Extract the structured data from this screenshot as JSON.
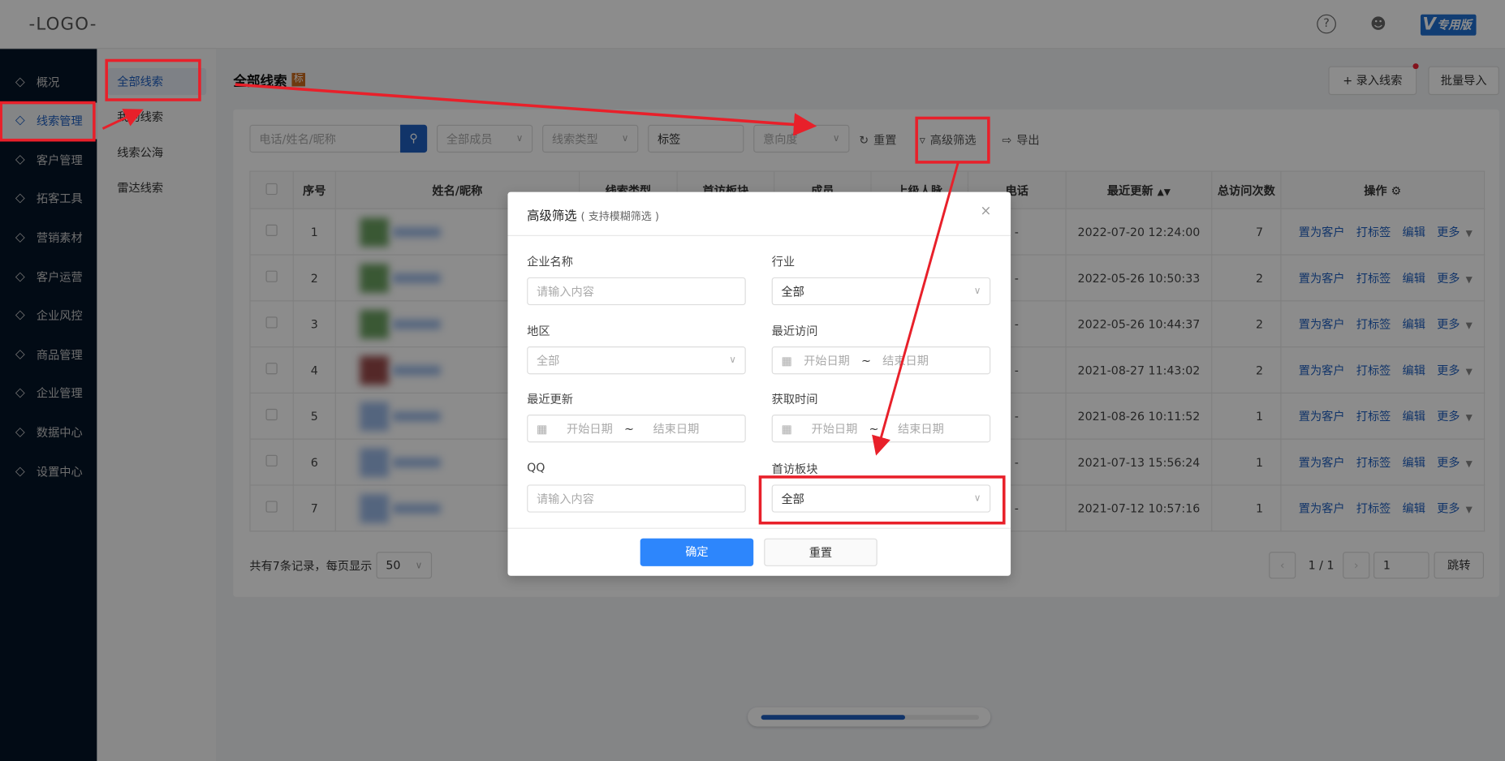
{
  "header": {
    "logo": "-LOGO-",
    "help_icon": "question-circle-icon",
    "user_icon": "user-icon",
    "edition_badge": "专用版",
    "edition_letter": "V"
  },
  "sidebar": {
    "items": [
      {
        "label": "概况",
        "icon": "home-icon"
      },
      {
        "label": "线索管理",
        "icon": "route-icon",
        "active": true
      },
      {
        "label": "客户管理",
        "icon": "users-icon"
      },
      {
        "label": "拓客工具",
        "icon": "handshake-icon"
      },
      {
        "label": "营销素材",
        "icon": "megaphone-icon"
      },
      {
        "label": "客户运营",
        "icon": "cycle-icon"
      },
      {
        "label": "企业风控",
        "icon": "message-icon"
      },
      {
        "label": "商品管理",
        "icon": "bag-icon"
      },
      {
        "label": "企业管理",
        "icon": "briefcase-icon"
      },
      {
        "label": "数据中心",
        "icon": "chart-icon"
      },
      {
        "label": "设置中心",
        "icon": "settings-icon"
      }
    ]
  },
  "submenu": {
    "items": [
      {
        "label": "全部线索",
        "active": true
      },
      {
        "label": "我的线索"
      },
      {
        "label": "线索公海"
      },
      {
        "label": "雷达线索"
      }
    ]
  },
  "page": {
    "title": "全部线索",
    "tag": "标",
    "add_button": "+ 录入线索",
    "import_button": "批量导入"
  },
  "filters": {
    "search_placeholder": "电话/姓名/昵称",
    "member": "全部成员",
    "type": "线索类型",
    "tag": "标签",
    "intent": "意向度",
    "reset": "重置",
    "advanced": "高级筛选",
    "export": "导出"
  },
  "table": {
    "headers": [
      "序号",
      "姓名/昵称",
      "线索类型",
      "首访板块",
      "成员",
      "上级人脉",
      "电话",
      "最近更新",
      "总访问次数",
      "操作"
    ],
    "rows": [
      {
        "no": "1",
        "phone": "-",
        "updated": "2022-07-20 12:24:00",
        "visits": "7"
      },
      {
        "no": "2",
        "phone": "-",
        "updated": "2022-05-26 10:50:33",
        "visits": "2"
      },
      {
        "no": "3",
        "phone": "-",
        "updated": "2022-05-26 10:44:37",
        "visits": "2"
      },
      {
        "no": "4",
        "phone": "-",
        "updated": "2021-08-27 11:43:02",
        "visits": "2"
      },
      {
        "no": "5",
        "phone": "-",
        "updated": "2021-08-26 10:11:52",
        "visits": "1"
      },
      {
        "no": "6",
        "phone": "-",
        "updated": "2021-07-13 15:56:24",
        "visits": "1"
      },
      {
        "no": "7",
        "phone": "-",
        "updated": "2021-07-12 10:57:16",
        "visits": "1"
      }
    ],
    "actions": [
      "置为客户",
      "打标签",
      "编辑",
      "更多"
    ]
  },
  "footer": {
    "total_text": "共有7条记录，每页显示",
    "page_size": "50",
    "page_info": "1 / 1",
    "page_input": "1",
    "jump": "跳转"
  },
  "scroll_progress": 0.66,
  "modal": {
    "title": "高级筛选",
    "subtitle": "( 支持模糊筛选 )",
    "close": "×",
    "company_label": "企业名称",
    "company_placeholder": "请输入内容",
    "industry_label": "行业",
    "industry_value": "全部",
    "region_label": "地区",
    "region_value": "全部",
    "last_visit_label": "最近访问",
    "last_update_label": "最近更新",
    "acquire_label": "获取时间",
    "start_date": "开始日期",
    "end_date": "结束日期",
    "tilde": "~",
    "qq_label": "QQ",
    "qq_placeholder": "请输入内容",
    "first_visit_label": "首访板块",
    "first_visit_value": "全部",
    "confirm": "确定",
    "reset": "重置"
  },
  "colors": {
    "primary": "#2d86fc",
    "link": "#1f5fbf",
    "sidebar": "#041427",
    "annotation": "#e8202a"
  }
}
